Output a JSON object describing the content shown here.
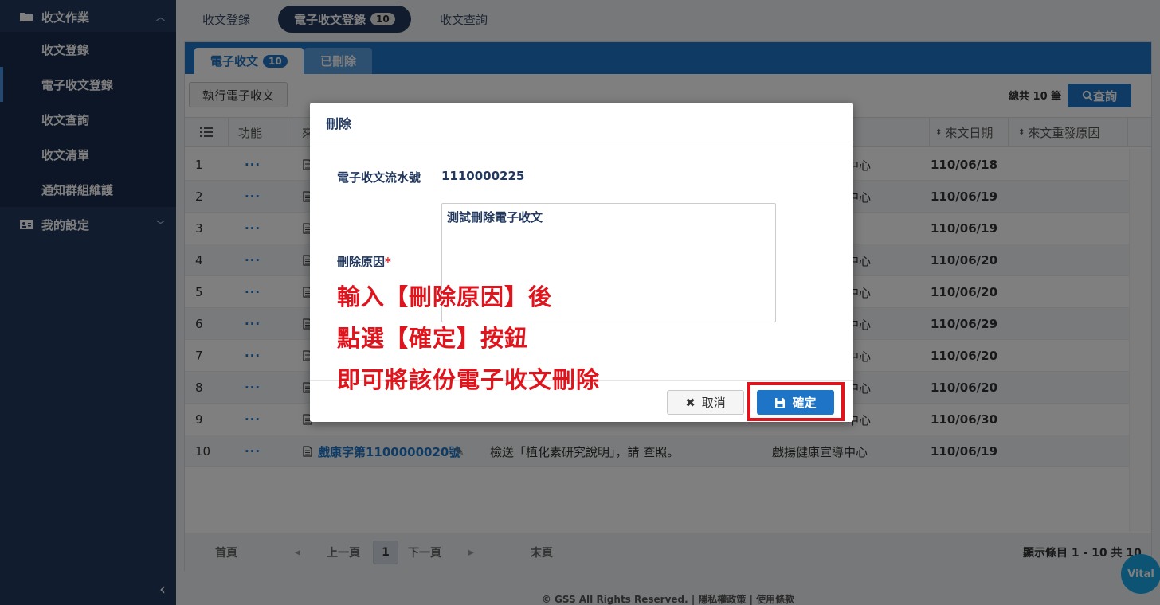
{
  "sidebar": {
    "group1": "收文作業",
    "items": [
      "收文登錄",
      "電子收文登錄",
      "收文查詢",
      "收文清單",
      "通知群組維護"
    ],
    "group2": "我的設定",
    "collapse_icon": "chevron-left-icon"
  },
  "top_tabs": [
    {
      "label": "收文登錄"
    },
    {
      "label": "電子收文登錄",
      "badge": "10"
    },
    {
      "label": "收文查詢"
    }
  ],
  "panel_tabs": [
    {
      "label": "電子收文",
      "badge": "10"
    },
    {
      "label": "已刪除"
    }
  ],
  "toolbar": {
    "exec_label": "執行電子收文",
    "total_label": "總共 10 筆",
    "query_label": "查詢"
  },
  "table": {
    "headers": {
      "func": "功能",
      "src": "來",
      "date": "來文日期",
      "reason": "來文重發原因"
    },
    "rows": [
      {
        "no": "1",
        "func": "···",
        "org_tail": "中心",
        "date": "110/06/18"
      },
      {
        "no": "2",
        "func": "···",
        "org_tail": "中心",
        "date": "110/06/19"
      },
      {
        "no": "3",
        "func": "···",
        "org_tail": "",
        "date": "110/06/19"
      },
      {
        "no": "4",
        "func": "···",
        "org_tail": "中心",
        "date": "110/06/20"
      },
      {
        "no": "5",
        "func": "···",
        "org_tail": "中心",
        "date": "110/06/20"
      },
      {
        "no": "6",
        "func": "···",
        "org_tail": "中心",
        "date": "110/06/29"
      },
      {
        "no": "7",
        "func": "···",
        "org_tail": "中心",
        "date": "110/06/20"
      },
      {
        "no": "8",
        "func": "···",
        "org_tail": "中心",
        "date": "110/06/20"
      },
      {
        "no": "9",
        "func": "···",
        "org_tail": "中心",
        "date": "110/06/30"
      },
      {
        "no": "10",
        "func": "···",
        "doc": "戲康字第1100000020號",
        "subject": "檢送「植化素研究說明」，請 查照。",
        "org": "戲揚健康宣導中心",
        "date": "110/06/19"
      }
    ]
  },
  "pager": {
    "first": "首頁",
    "prev": "上一頁",
    "page": "1",
    "next": "下一頁",
    "last": "末頁",
    "info": "顯示條目 1 - 10 共 10"
  },
  "footer": {
    "text": "© GSS All Rights Reserved. |  隱私權政策 |  使用條款"
  },
  "vital_label": "Vital",
  "modal": {
    "title": "刪除",
    "serial_label": "電子收文流水號",
    "serial_value": "1110000225",
    "reason_label": "刪除原因",
    "reason_required": "*",
    "reason_value": "測試刪除電子收文",
    "cancel_label": "取消",
    "ok_label": "確定"
  },
  "annotations": [
    "輸入【刪除原因】後",
    "點選【確定】按鈕",
    "即可將該份電子收文刪除"
  ],
  "colors": {
    "sidebar": "#22385e",
    "accent": "#1e74c6",
    "annotation": "#e0141c"
  }
}
